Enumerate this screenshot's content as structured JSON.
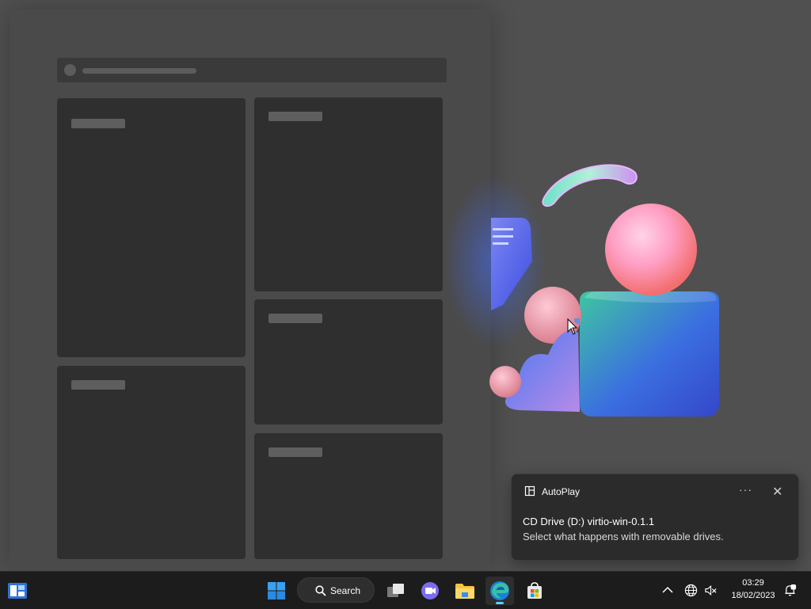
{
  "notification": {
    "app_name": "AutoPlay",
    "more_label": "···",
    "close_label": "✕",
    "title": "CD Drive (D:) virtio-win-0.1.1",
    "body": "Select what happens with removable drives."
  },
  "taskbar": {
    "search_label": "Search",
    "apps": [
      {
        "name": "start",
        "icon": "windows-logo-icon"
      },
      {
        "name": "task-view",
        "icon": "task-view-icon"
      },
      {
        "name": "chat",
        "icon": "teams-chat-icon"
      },
      {
        "name": "file-explorer",
        "icon": "folder-icon"
      },
      {
        "name": "edge",
        "icon": "edge-icon",
        "active": true
      },
      {
        "name": "microsoft-store",
        "icon": "store-icon"
      }
    ],
    "tray": {
      "time": "03:29",
      "date": "18/02/2023"
    }
  },
  "colors": {
    "accent": "#60cdff",
    "taskbar": "#1c1c1c",
    "toast_bg": "#2b2b2b"
  }
}
